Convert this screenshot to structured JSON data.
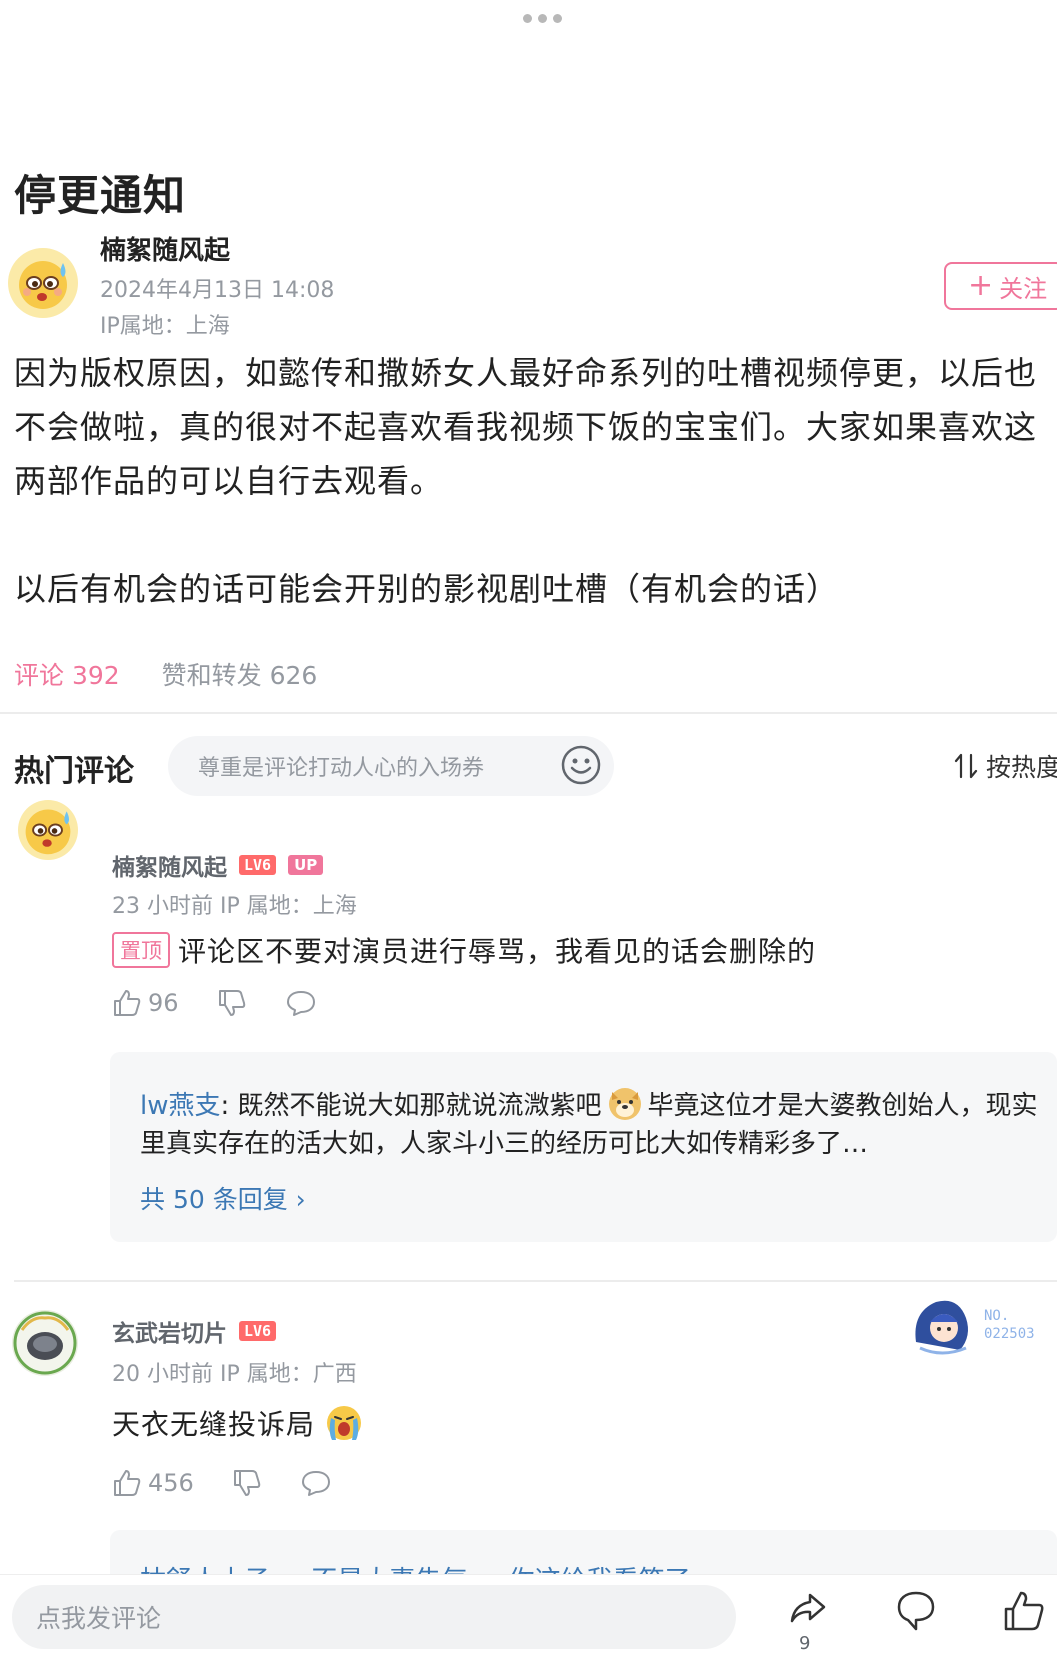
{
  "post": {
    "title": "停更通知",
    "author": "楠絮随风起",
    "date": "2024年4月13日 14:08",
    "ip": "IP属地：上海",
    "follow_label": "关注",
    "body_p1": "因为版权原因，如懿传和撒娇女人最好命系列的吐槽视频停更，以后也不会做啦，真的很对不起喜欢看我视频下饭的宝宝们。大家如果喜欢这两部作品的可以自行去观看。",
    "body_p2": "以后有机会的话可能会开别的影视剧吐槽（有机会的话）"
  },
  "tabs": {
    "comments": "评论 392",
    "likes_reposts": "赞和转发 626"
  },
  "hot": {
    "label": "热门评论",
    "input_placeholder": "尊重是评论打动人心的入场券",
    "sort_label": "按热度"
  },
  "comments": [
    {
      "name": "楠絮随风起",
      "level": "LV6",
      "up_badge": "UP",
      "meta": "23 小时前  IP 属地：上海",
      "pin": "置顶",
      "text": "评论区不要对演员进行辱骂，我看见的话会删除的",
      "likes": "96",
      "reply": {
        "user": "lw燕支",
        "text_part1": ": 既然不能说大如那就说流溦紫吧",
        "text_part2": "毕竟这位才是大婆教创始人，现实里真实存在的活大如，人家斗小三的经历可比大如传精彩多了…",
        "more": "共 50 条回复 ›"
      }
    },
    {
      "name": "玄武岩切片",
      "level": "LV6",
      "meta": "20 小时前  IP 属地：广西",
      "text": "天衣无缝投诉局",
      "likes": "456",
      "fan_no_label": "NO.",
      "fan_no_value": "022503",
      "reply_peek": "枯舒人士子 ... 不是大妻告气 ... 你这给我看笑了"
    }
  ],
  "bottom": {
    "input_placeholder": "点我发评论",
    "share_count": "9"
  },
  "colors": {
    "accent": "#f0769b",
    "link": "#3c78b4",
    "muted": "#9499a0"
  }
}
